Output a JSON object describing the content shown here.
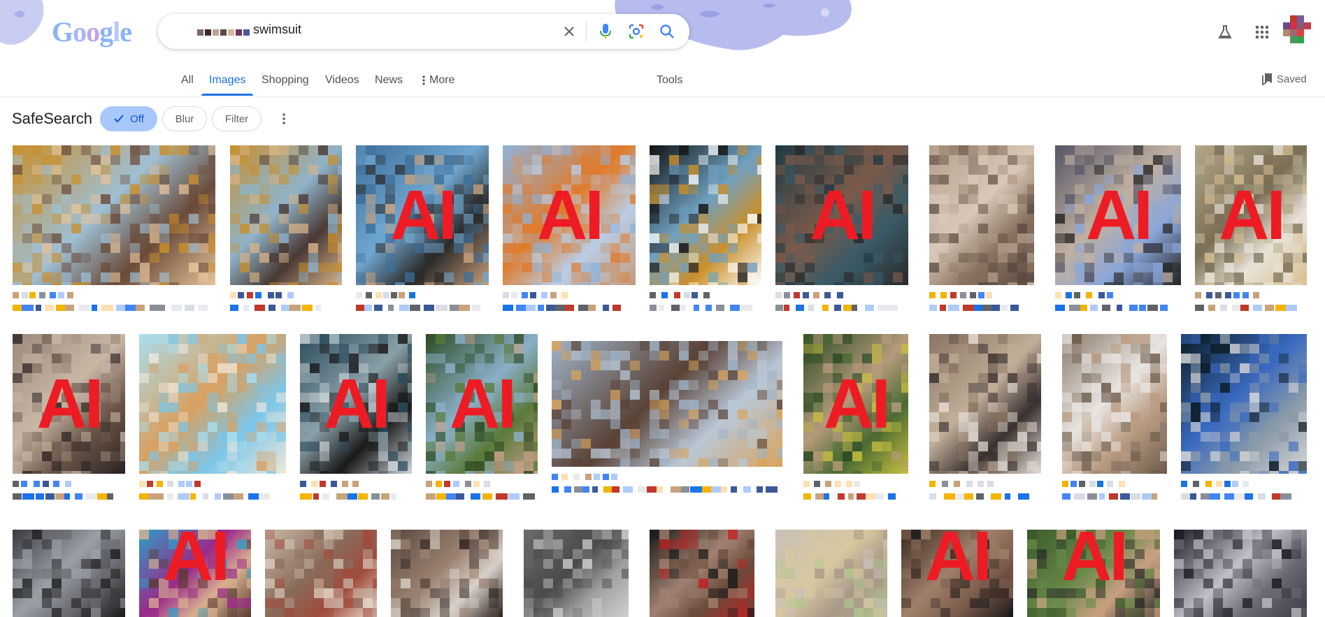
{
  "header": {
    "logo_text": "Google",
    "logo_letters": [
      {
        "char": "G",
        "color": "#8ab4f8"
      },
      {
        "char": "o",
        "color": "#a7b6f5"
      },
      {
        "char": "o",
        "color": "#c0a5e8"
      },
      {
        "char": "g",
        "color": "#8ab4f8"
      },
      {
        "char": "l",
        "color": "#b7c8f8"
      },
      {
        "char": "e",
        "color": "#8ab4f8"
      }
    ],
    "search": {
      "query": "swimsuit",
      "clear_icon": "close-icon",
      "voice_icon": "microphone-icon",
      "lens_icon": "google-lens-icon",
      "search_icon": "search-icon"
    },
    "labs_icon": "flask-icon",
    "apps_icon": "apps-grid-icon",
    "account_icon": "avatar"
  },
  "tabs": {
    "items": [
      {
        "label": "All",
        "active": false
      },
      {
        "label": "Images",
        "active": true
      },
      {
        "label": "Shopping",
        "active": false
      },
      {
        "label": "Videos",
        "active": false
      },
      {
        "label": "News",
        "active": false
      },
      {
        "label": "More",
        "active": false
      }
    ],
    "tools_label": "Tools",
    "saved_label": "Saved"
  },
  "safesearch": {
    "label": "SafeSearch",
    "options": [
      {
        "label": "Off",
        "selected": true
      },
      {
        "label": "Blur",
        "selected": false
      },
      {
        "label": "Filter",
        "selected": false
      }
    ]
  },
  "results": {
    "overlay_label": "AI",
    "thumbnails": [
      {
        "ai": false,
        "colors": [
          "#c98f2a",
          "#6a4b3a",
          "#9fbfd3",
          "#e7c39a"
        ]
      },
      {
        "ai": false,
        "colors": [
          "#c98f2a",
          "#4a3a35",
          "#8fb3c8",
          "#d9b488"
        ]
      },
      {
        "ai": true,
        "colors": [
          "#3d6f9a",
          "#2b2b2b",
          "#6fa6cf",
          "#c9a07a"
        ]
      },
      {
        "ai": true,
        "colors": [
          "#8fb3d9",
          "#b9cde4",
          "#e07a2a",
          "#c69a7a"
        ]
      },
      {
        "ai": false,
        "colors": [
          "#111111",
          "#c98f2a",
          "#6fa0c0",
          "#ffffff"
        ]
      },
      {
        "ai": true,
        "colors": [
          "#1e3a44",
          "#3a5a66",
          "#7a5a4a",
          "#2a2a2a"
        ]
      },
      {
        "ai": false,
        "colors": [
          "#b49e8a",
          "#8a7260",
          "#d8c8b8",
          "#5a4a40"
        ]
      },
      {
        "ai": true,
        "colors": [
          "#555566",
          "#8aa6d9",
          "#c0b0a0",
          "#222222"
        ]
      },
      {
        "ai": true,
        "colors": [
          "#b4a88a",
          "#e8e2d8",
          "#7a6e55",
          "#d8c090"
        ]
      },
      {
        "ai": true,
        "colors": [
          "#9a8a7a",
          "#6a5548",
          "#c9b7a6",
          "#2a2222"
        ]
      },
      {
        "ai": false,
        "colors": [
          "#a8dff0",
          "#7cc6e8",
          "#d9a060",
          "#f0e8dc"
        ]
      },
      {
        "ai": true,
        "colors": [
          "#2a4a5a",
          "#1a1a1a",
          "#8aa0a8",
          "#d0d8dc"
        ]
      },
      {
        "ai": true,
        "colors": [
          "#2c4a22",
          "#5a7a3a",
          "#8ab0c8",
          "#c8a088"
        ]
      },
      {
        "ai": false,
        "colors": [
          "#9fb3c8",
          "#b9c7d6",
          "#5a4236",
          "#d9a45a"
        ]
      },
      {
        "ai": true,
        "colors": [
          "#2a4a22",
          "#4a6a32",
          "#b49a7a",
          "#c8c040"
        ]
      },
      {
        "ai": false,
        "colors": [
          "#8a7462",
          "#3a3030",
          "#c0ae98",
          "#e8e0d8"
        ]
      },
      {
        "ai": false,
        "colors": [
          "#8a7a6a",
          "#b89a80",
          "#e8e4e0",
          "#6a5a4a"
        ]
      },
      {
        "ai": false,
        "colors": [
          "#0a1a22",
          "#8a9aa8",
          "#3a6ac0",
          "#d8d8d8"
        ]
      },
      {
        "ai": false,
        "colors": [
          "#3a3a40",
          "#6a6a70",
          "#9aa0a6",
          "#1a1a1a"
        ]
      },
      {
        "ai": true,
        "colors": [
          "#2aa0c8",
          "#d8b090",
          "#9a2a8a",
          "#5a3a30"
        ]
      },
      {
        "ai": false,
        "colors": [
          "#c8b8a8",
          "#a04a3a",
          "#8a6a5a",
          "#e8ddd0"
        ]
      },
      {
        "ai": false,
        "colors": [
          "#5a4a40",
          "#d8d0c8",
          "#9a8070",
          "#2a2020"
        ]
      },
      {
        "ai": false,
        "colors": [
          "#6a6a6a",
          "#a0a0a0",
          "#4a4a4a",
          "#d0d0d0"
        ]
      },
      {
        "ai": false,
        "colors": [
          "#1a1a1a",
          "#6a4a3a",
          "#a08070",
          "#c02020"
        ]
      },
      {
        "ai": false,
        "colors": [
          "#c8c0b8",
          "#a89888",
          "#d8c8a0",
          "#b0c890"
        ]
      },
      {
        "ai": true,
        "colors": [
          "#3a2a22",
          "#7a5a4a",
          "#a0806a",
          "#1a1a1a"
        ]
      },
      {
        "ai": true,
        "colors": [
          "#3a5a2a",
          "#c8a080",
          "#6a8a4a",
          "#2a2a2a"
        ]
      },
      {
        "ai": false,
        "colors": [
          "#1a1a22",
          "#6a6a74",
          "#c0c0c8",
          "#3a3a44"
        ]
      }
    ],
    "meta_colors": [
      "#4285f4",
      "#d8dde6",
      "#f4b400",
      "#8a8f99",
      "#c9a27a",
      "#3b5998",
      "#c0392b",
      "#ffe0b2",
      "#1a73e8",
      "#e8eaed",
      "#5f6368",
      "#aecbfa"
    ]
  }
}
